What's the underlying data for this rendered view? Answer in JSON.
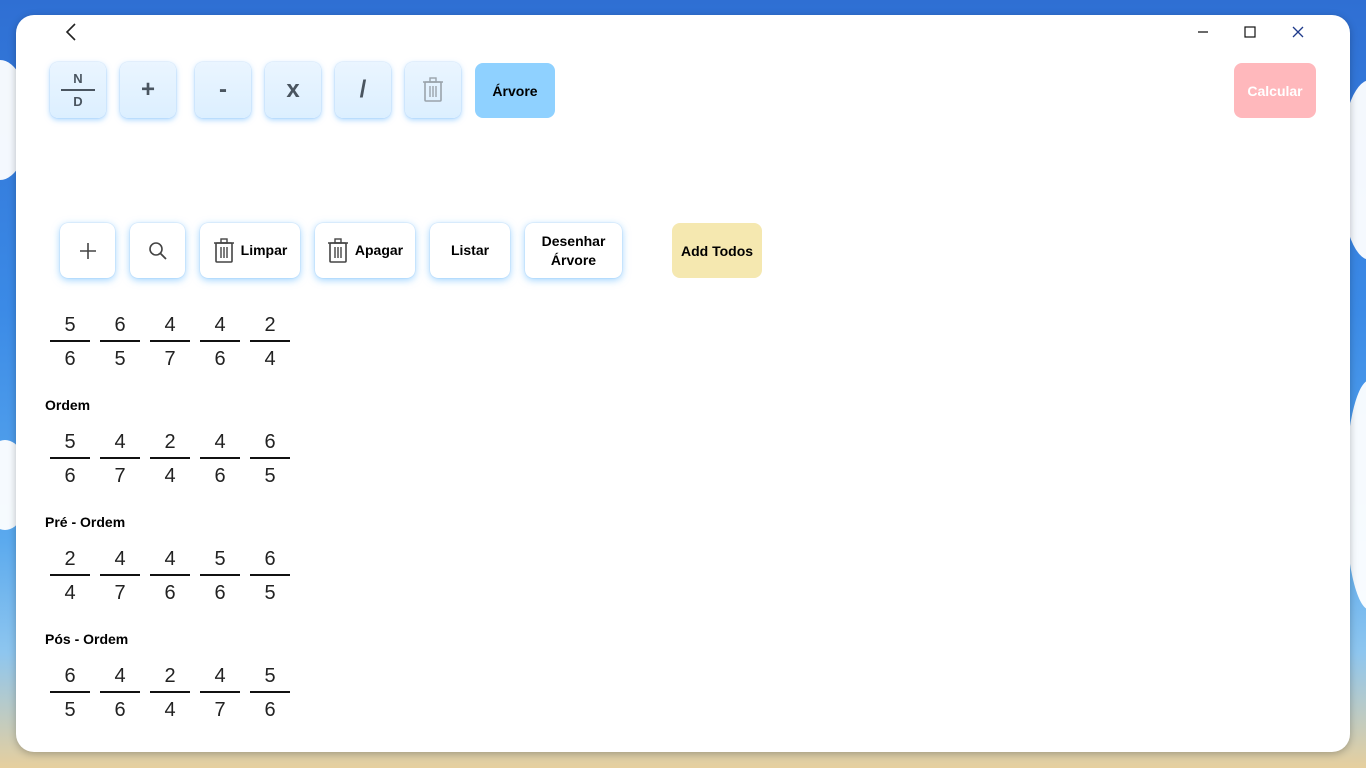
{
  "toolbar": {
    "fraction_numerator": "N",
    "fraction_denominator": "D",
    "plus": "+",
    "minus": "-",
    "multiply": "x",
    "divide": "/",
    "arvore": "Árvore",
    "calcular": "Calcular"
  },
  "tree_toolbar": {
    "limpar": "Limpar",
    "apagar": "Apagar",
    "listar": "Listar",
    "desenhar_line1": "Desenhar",
    "desenhar_line2": "Árvore",
    "add_todos": "Add Todos"
  },
  "icons": {
    "back": "chevron-left-icon",
    "minimize": "minimize-icon",
    "maximize": "maximize-icon",
    "close": "close-icon",
    "delete": "trash-icon",
    "add": "plus-icon",
    "search": "search-icon"
  },
  "colors": {
    "arvore_button": "#8fd1ff",
    "calcular_button": "#ffb8bc",
    "add_todos_button": "#f5e8b0",
    "op_button": "#dcefff"
  },
  "lists": {
    "inserted": {
      "label": "",
      "items": [
        [
          "5",
          "6"
        ],
        [
          "6",
          "5"
        ],
        [
          "4",
          "7"
        ],
        [
          "4",
          "6"
        ],
        [
          "2",
          "4"
        ]
      ]
    },
    "ordem": {
      "label": "Ordem",
      "items": [
        [
          "5",
          "6"
        ],
        [
          "4",
          "7"
        ],
        [
          "2",
          "4"
        ],
        [
          "4",
          "6"
        ],
        [
          "6",
          "5"
        ]
      ]
    },
    "pre_ordem": {
      "label": "Pré - Ordem",
      "items": [
        [
          "2",
          "4"
        ],
        [
          "4",
          "7"
        ],
        [
          "4",
          "6"
        ],
        [
          "5",
          "6"
        ],
        [
          "6",
          "5"
        ]
      ]
    },
    "pos_ordem": {
      "label": "Pós - Ordem",
      "items": [
        [
          "6",
          "5"
        ],
        [
          "4",
          "6"
        ],
        [
          "2",
          "4"
        ],
        [
          "4",
          "7"
        ],
        [
          "5",
          "6"
        ]
      ]
    }
  }
}
